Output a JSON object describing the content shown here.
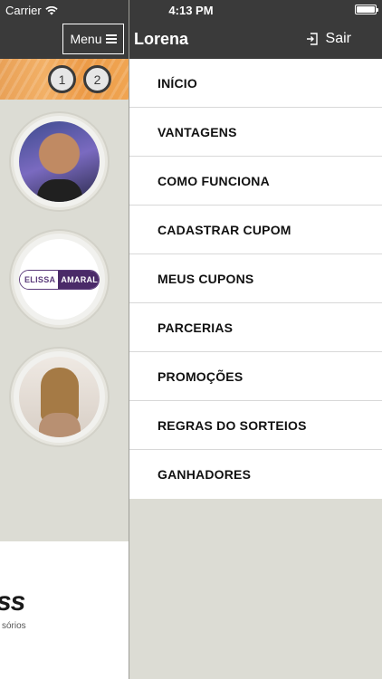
{
  "status_bar": {
    "carrier": "Carrier",
    "time": "4:13 PM",
    "wifi_icon": "wifi-icon",
    "battery_level": 1.0
  },
  "header": {
    "menu_label": "Menu",
    "user_name": "Lorena",
    "logout_label": "Sair"
  },
  "left_pane": {
    "pages": [
      "1",
      "2"
    ],
    "logo_text_left": "ELISSA",
    "logo_text_right": "AMARAL",
    "partial_logo": "ss",
    "partial_sub": "sórios"
  },
  "drawer": {
    "items": [
      "INÍCIO",
      "VANTAGENS",
      "COMO FUNCIONA",
      "CADASTRAR CUPOM",
      "MEUS CUPONS",
      "PARCERIAS",
      "PROMOÇÕES",
      "REGRAS DO SORTEIOS",
      "GANHADORES"
    ]
  },
  "colors": {
    "header_bg": "#3a3a3a",
    "banner_orange": "#f0a552",
    "drawer_bg": "#ffffff",
    "page_bg": "#dcdcd4"
  }
}
